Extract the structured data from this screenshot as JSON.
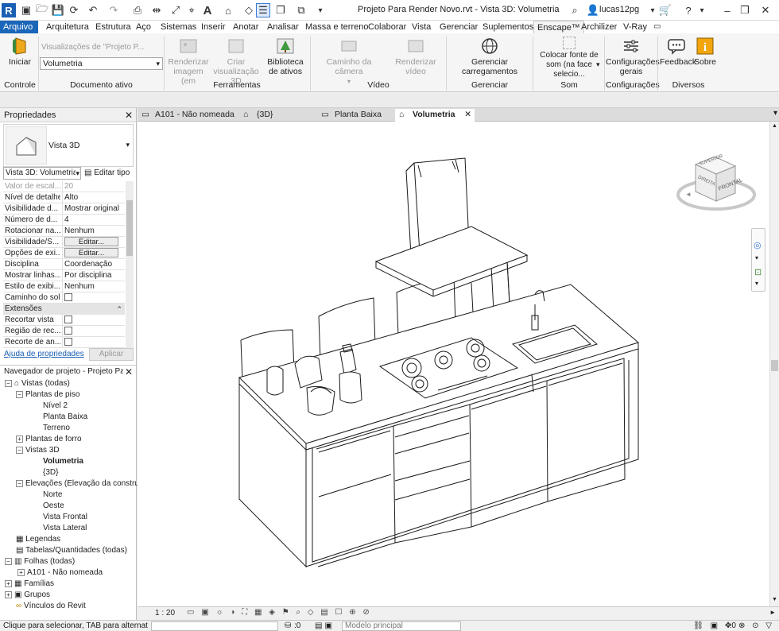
{
  "window": {
    "title": "Projeto Para Render Novo.rvt - Vista 3D: Volumetria",
    "user": "lucas12pg"
  },
  "menus": [
    "Arquivo",
    "Arquitetura",
    "Estrutura",
    "Aço",
    "Sistemas",
    "Inserir",
    "Anotar",
    "Analisar",
    "Massa e terreno",
    "Colaborar",
    "Vista",
    "Gerenciar",
    "Suplementos",
    "Enscape™",
    "Archilizer",
    "V-Ray"
  ],
  "ribbon": {
    "iniciar": "Iniciar",
    "controle": "Controle",
    "doc_visualizacoes": "Visualizações de \"Projeto P...",
    "doc_select": "Volumetria",
    "documento_ativo": "Documento ativo",
    "renderizar_imagem": "Renderizar imagem (em",
    "criar_visualizacao": "Criar visualização 3D",
    "biblioteca": "Biblioteca de ativos",
    "ferramentas": "Ferramentas",
    "caminho_camera": "Caminho da câmera",
    "renderizar_video": "Renderizar vídeo",
    "video": "Vídeo",
    "gerenciar_carregamentos": "Gerenciar carregamentos",
    "gerenciar_carregamentos_panel": "Gerenciar carregamentos",
    "colocar_som": "Colocar fonte de som (na face selecio...",
    "som": "Som",
    "config_gerais": "Configurações gerais",
    "configuracoes": "Configurações",
    "feedback": "Feedback",
    "sobre": "Sobre",
    "diversos": "Diversos"
  },
  "properties": {
    "title": "Propriedades",
    "type_name": "Vista 3D",
    "instance_select": "Vista 3D: Volumetria",
    "edit_type": "Editar tipo",
    "rows": [
      {
        "k": "Valor de escal...",
        "v": "20"
      },
      {
        "k": "Nível de detalhe",
        "v": "Alto"
      },
      {
        "k": "Visibilidade d...",
        "v": "Mostrar original"
      },
      {
        "k": "Número de d...",
        "v": "4"
      },
      {
        "k": "Rotacionar na...",
        "v": "Nenhum"
      },
      {
        "k": "Visibilidade/S...",
        "v": "Editar..."
      },
      {
        "k": "Opções de exi...",
        "v": "Editar..."
      },
      {
        "k": "Disciplina",
        "v": "Coordenação"
      },
      {
        "k": "Mostrar linhas...",
        "v": "Por disciplina"
      },
      {
        "k": "Estilo de exibi...",
        "v": "Nenhum"
      },
      {
        "k": "Caminho do sol",
        "v": ""
      }
    ],
    "group_extensoes": "Extensões",
    "ext_rows": [
      {
        "k": "Recortar vista",
        "v": ""
      },
      {
        "k": "Região de rec...",
        "v": ""
      },
      {
        "k": "Recorte de an...",
        "v": ""
      }
    ],
    "help_link": "Ajuda de propriedades",
    "apply": "Aplicar"
  },
  "navigator": {
    "title": "Navegador de projeto - Projeto Par...",
    "items": [
      {
        "label": "Vistas (todas)"
      },
      {
        "label": "Plantas de piso"
      },
      {
        "label": "Nível 2"
      },
      {
        "label": "Planta Baixa"
      },
      {
        "label": "Terreno"
      },
      {
        "label": "Plantas de forro"
      },
      {
        "label": "Vistas 3D"
      },
      {
        "label": "Volumetria"
      },
      {
        "label": "{3D}"
      },
      {
        "label": "Elevações (Elevação da construç"
      },
      {
        "label": "Norte"
      },
      {
        "label": "Oeste"
      },
      {
        "label": "Vista Frontal"
      },
      {
        "label": "Vista Lateral"
      },
      {
        "label": "Legendas"
      },
      {
        "label": "Tabelas/Quantidades (todas)"
      },
      {
        "label": "Folhas (todas)"
      },
      {
        "label": "A101 - Não nomeada"
      },
      {
        "label": "Famílias"
      },
      {
        "label": "Grupos"
      },
      {
        "label": "Vínculos do Revit"
      }
    ]
  },
  "tabs": [
    {
      "label": "A101 - Não nomeada"
    },
    {
      "label": "{3D}"
    },
    {
      "label": "Planta Baixa"
    },
    {
      "label": "Volumetria"
    }
  ],
  "viewcube": {
    "top": "SUPERIOR",
    "front": "FRONTAL",
    "right": "DIREITA"
  },
  "view_control": {
    "scale": "1 : 20"
  },
  "status": {
    "hint": "Clique para selecionar, TAB para alternat",
    "workset": ":0",
    "model": "Modelo principal",
    "sel_count": ":0"
  }
}
